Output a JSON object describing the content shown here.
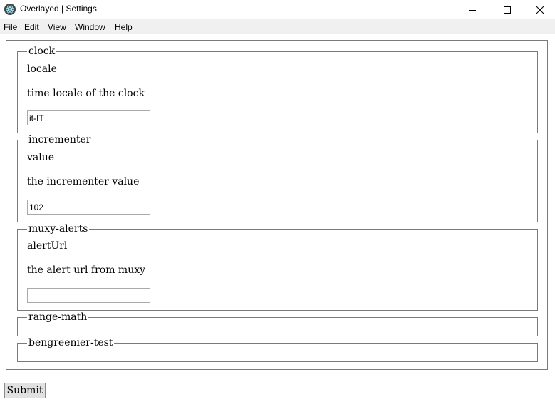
{
  "window": {
    "title": "Overlayed | Settings",
    "icon": "electron-app-icon"
  },
  "menu": {
    "items": [
      "File",
      "Edit",
      "View",
      "Window",
      "Help"
    ]
  },
  "form": {
    "sections": [
      {
        "legend": "clock",
        "field_label": "locale",
        "description": "time locale of the clock",
        "value": "it-IT"
      },
      {
        "legend": "incrementer",
        "field_label": "value",
        "description": "the incrementer value",
        "value": "102"
      },
      {
        "legend": "muxy-alerts",
        "field_label": "alertUrl",
        "description": "the alert url from muxy",
        "value": ""
      },
      {
        "legend": "range-math"
      },
      {
        "legend": "bengreenier-test"
      }
    ],
    "submit_label": "Submit"
  }
}
